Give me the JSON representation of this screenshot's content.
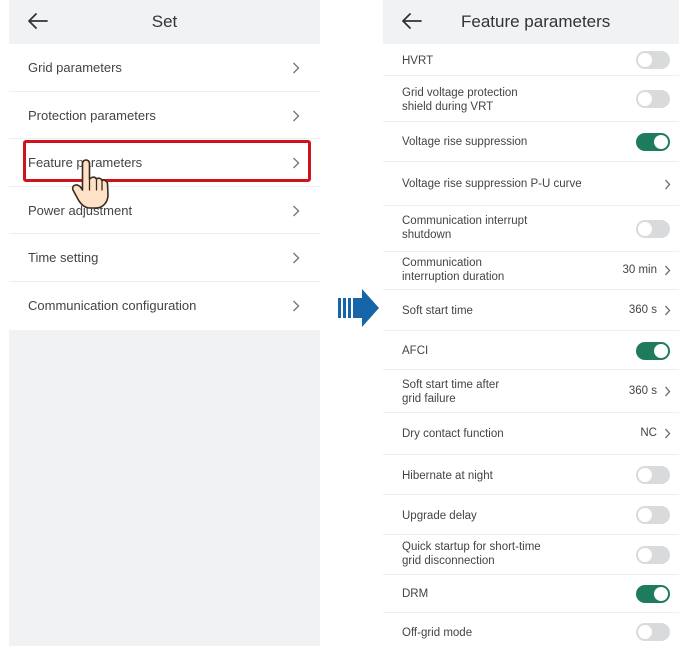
{
  "left": {
    "title": "Set",
    "items": [
      {
        "label": "Grid parameters"
      },
      {
        "label": "Protection parameters"
      },
      {
        "label": "Feature parameters"
      },
      {
        "label": "Power adjustment"
      },
      {
        "label": "Time setting"
      },
      {
        "label": "Communication configuration"
      }
    ]
  },
  "right": {
    "title": "Feature parameters",
    "rows": [
      {
        "label": "HVRT",
        "kind": "toggle",
        "on": false
      },
      {
        "label": "Grid voltage protection\nshield during VRT",
        "kind": "toggle",
        "on": false
      },
      {
        "label": "Voltage rise suppression",
        "kind": "toggle",
        "on": true
      },
      {
        "label": "Voltage rise suppression P-U curve",
        "kind": "nav"
      },
      {
        "label": "Communication interrupt\nshutdown",
        "kind": "toggle",
        "on": false
      },
      {
        "label": "Communication\ninterruption duration",
        "kind": "value",
        "value": "30 min"
      },
      {
        "label": "Soft start time",
        "kind": "value",
        "value": "360 s"
      },
      {
        "label": "AFCI",
        "kind": "toggle",
        "on": true
      },
      {
        "label": "Soft start time after\ngrid failure",
        "kind": "value",
        "value": "360 s"
      },
      {
        "label": "Dry contact function",
        "kind": "value",
        "value": "NC"
      },
      {
        "label": "Hibernate at night",
        "kind": "toggle",
        "on": false
      },
      {
        "label": "Upgrade delay",
        "kind": "toggle",
        "on": false
      },
      {
        "label": "Quick startup for short-time\ngrid disconnection",
        "kind": "toggle",
        "on": false
      },
      {
        "label": "DRM",
        "kind": "toggle",
        "on": true
      },
      {
        "label": "Off-grid mode",
        "kind": "toggle",
        "on": false
      }
    ]
  },
  "colors": {
    "highlight": "#d0121b",
    "toggle_on": "#1f7b5e",
    "toggle_off": "#d9dadb",
    "arrow": "#1565a8"
  },
  "icons": {
    "back": "arrow-left-icon",
    "chevron": "chevron-right-icon",
    "pointer": "hand-pointer-icon",
    "flow": "right-arrow-icon"
  }
}
